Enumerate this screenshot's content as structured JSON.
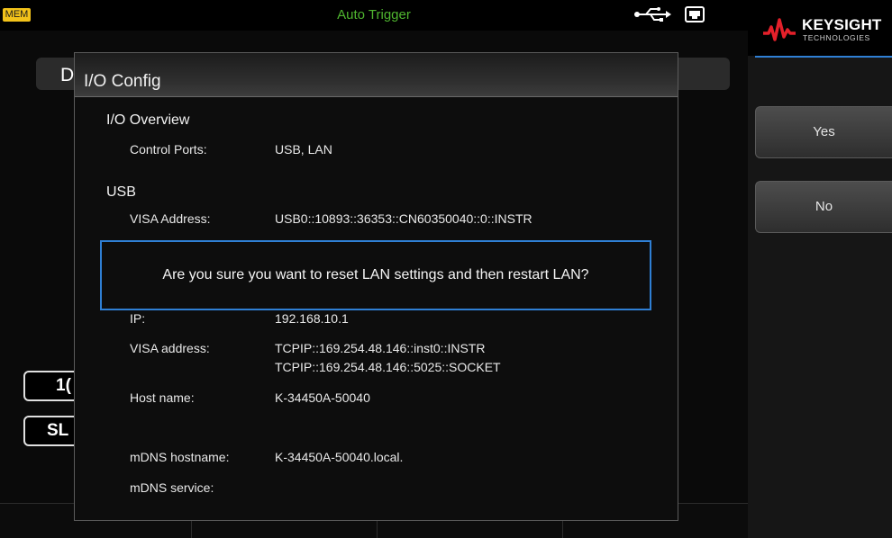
{
  "status_bar": {
    "mem_badge": "MEM",
    "trigger_mode": "Auto Trigger",
    "usb_icon": "usb-icon",
    "lan_icon": "lan-icon"
  },
  "background": {
    "title_partial": "D",
    "box1_partial": "1(",
    "box2_partial": "SL"
  },
  "brand": {
    "name": "KEYSIGHT",
    "subtitle": "TECHNOLOGIES",
    "wave_color": "#e4202a"
  },
  "softkeys": {
    "yes_label": "Yes",
    "no_label": "No"
  },
  "dialog": {
    "title": "I/O Config",
    "sections": {
      "overview": {
        "heading": "I/O Overview",
        "control_ports_label": "Control Ports:",
        "control_ports_value": "USB, LAN"
      },
      "usb": {
        "heading": "USB",
        "visa_label": "VISA Address:",
        "visa_value": "USB0::10893::36353::CN60350040::0::INSTR"
      },
      "lan": {
        "ip_label": "IP:",
        "ip_value": "192.168.10.1",
        "visa_label": "VISA address:",
        "visa_value_1": "TCPIP::169.254.48.146::inst0::INSTR",
        "visa_value_2": "TCPIP::169.254.48.146::5025::SOCKET",
        "host_label": "Host name:",
        "host_value": "K-34450A-50040",
        "mdns_host_label": "mDNS hostname:",
        "mdns_host_value": "K-34450A-50040.local.",
        "mdns_service_label": "mDNS service:",
        "mdns_service_value": ""
      }
    },
    "confirm_message": "Are you sure you want to reset LAN settings and then restart LAN?"
  },
  "colors": {
    "mem_badge": "#f2c21a",
    "trigger_text": "#4fb52f",
    "accent_blue": "#2f7fd4",
    "brand_red": "#e4202a"
  }
}
